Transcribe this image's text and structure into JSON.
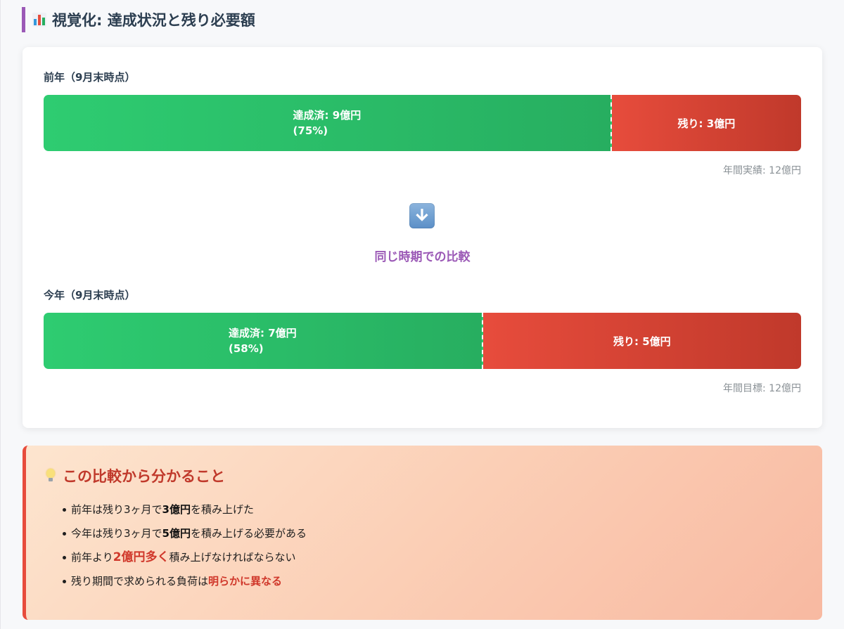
{
  "section": {
    "title": "視覚化: 達成状況と残り必要額",
    "icon": "bar-chart-icon"
  },
  "colors": {
    "accent": "#9b59b6",
    "achieved": "#27ae60",
    "remaining": "#e74c3c",
    "insight_border": "#e74c3c"
  },
  "previous": {
    "label": "前年（9月末時点）",
    "achieved_fraction": 0.75,
    "achieved_line1": "達成済: 9億円",
    "achieved_line2": "(75%)",
    "remaining": "残り: 3億円",
    "total": "年間実績: 12億円"
  },
  "comparison": {
    "icon": "down-arrow-icon",
    "label": "同じ時期での比較"
  },
  "current": {
    "label": "今年（9月末時点）",
    "achieved_fraction": 0.58,
    "achieved_line1": "達成済: 7億円",
    "achieved_line2": "(58%)",
    "remaining": "残り: 5億円",
    "total": "年間目標: 12億円"
  },
  "insight": {
    "icon": "lightbulb-icon",
    "title": "この比較から分かること",
    "items": [
      {
        "pre": "前年は残り3ヶ月で",
        "em": "3億円",
        "post": "を積み上げた"
      },
      {
        "pre": "今年は残り3ヶ月で",
        "em": "5億円",
        "post": "を積み上げる必要がある"
      },
      {
        "pre": "前年より",
        "em": "2億円多く",
        "post": "積み上げなければならない"
      },
      {
        "pre": "残り期間で求められる負荷は",
        "em": "明らかに異なる",
        "post": ""
      }
    ]
  }
}
